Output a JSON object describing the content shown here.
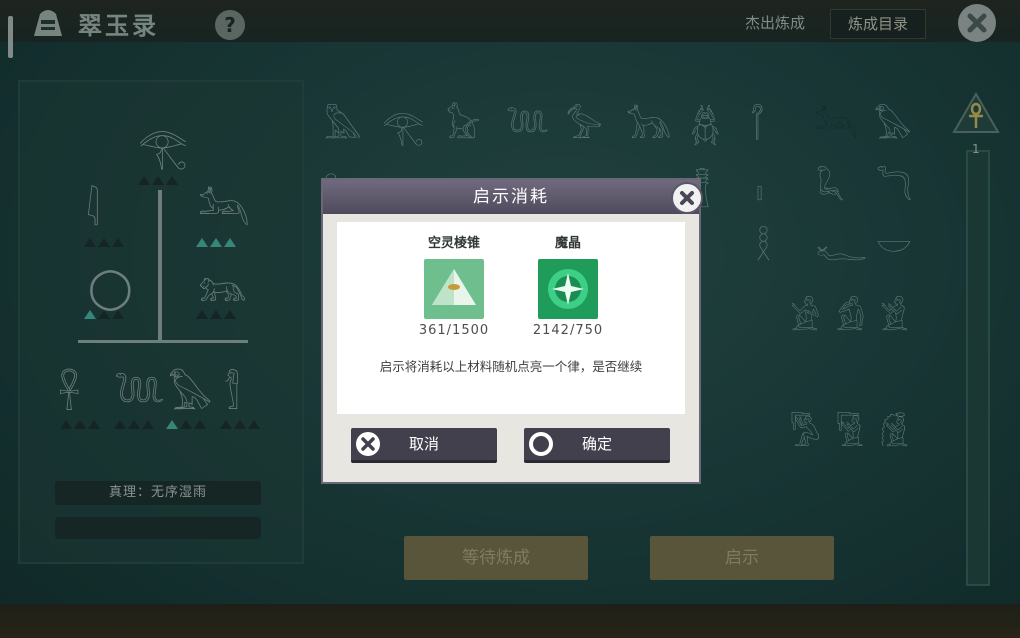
{
  "header": {
    "title": "翠玉录",
    "help_glyph": "?",
    "tab_outstanding": "杰出炼成",
    "tab_catalog": "炼成目录",
    "close_icon": "close-icon"
  },
  "tree": {
    "truth_label": "真理：无序湿雨"
  },
  "side_rail": {
    "level": "1"
  },
  "actions": {
    "wait_label": "等待炼成",
    "reveal_label": "启示"
  },
  "modal": {
    "title": "启示消耗",
    "materials": [
      {
        "name": "空灵棱锥",
        "count": "361/1500",
        "icon": "pyramid-icon",
        "color": "#7fc99c"
      },
      {
        "name": "魔晶",
        "count": "2142/750",
        "icon": "crystal-orb-icon",
        "color": "#2db26a"
      }
    ],
    "description": "启示将消耗以上材料随机点亮一个律，是否继续",
    "cancel_label": "取消",
    "confirm_label": "确定"
  }
}
